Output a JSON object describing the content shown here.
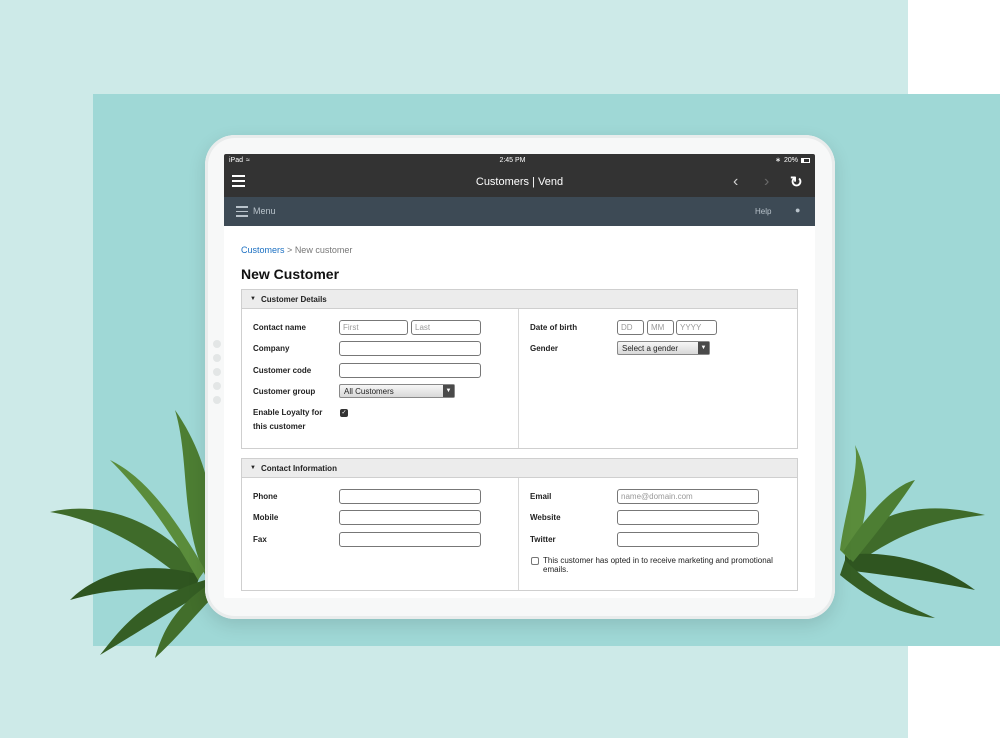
{
  "statusbar": {
    "device": "iPad",
    "time": "2:45 PM",
    "battery": "20%"
  },
  "navbar": {
    "title": "Customers | Vend"
  },
  "menubar": {
    "menu_label": "Menu",
    "help_label": "Help"
  },
  "breadcrumb": {
    "link": "Customers",
    "separator": ">",
    "current": "New customer"
  },
  "page_title": "New Customer",
  "customer_details": {
    "heading": "Customer Details",
    "contact_name_label": "Contact name",
    "first_placeholder": "First",
    "last_placeholder": "Last",
    "company_label": "Company",
    "customer_code_label": "Customer code",
    "customer_group_label": "Customer group",
    "customer_group_value": "All Customers",
    "loyalty_label_1": "Enable Loyalty for",
    "loyalty_label_2": "this customer",
    "loyalty_checked": true,
    "dob_label": "Date of birth",
    "dd_placeholder": "DD",
    "mm_placeholder": "MM",
    "yyyy_placeholder": "YYYY",
    "gender_label": "Gender",
    "gender_value": "Select a gender"
  },
  "contact_information": {
    "heading": "Contact Information",
    "phone_label": "Phone",
    "mobile_label": "Mobile",
    "fax_label": "Fax",
    "email_label": "Email",
    "email_placeholder": "name@domain.com",
    "website_label": "Website",
    "twitter_label": "Twitter",
    "optin_label": "This customer has opted in to receive marketing and promotional emails.",
    "optin_checked": false
  },
  "colors": {
    "background_light": "#cdeae8",
    "background_dark": "#9fd8d6",
    "navbar": "#333333",
    "menubar": "#3d4a55",
    "link": "#1a6fc2"
  }
}
